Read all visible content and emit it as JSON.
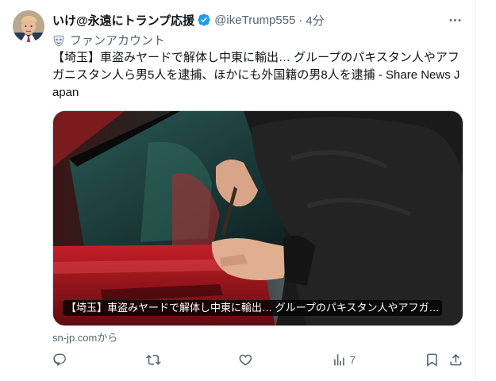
{
  "tweet": {
    "display_name": "いけ@永遠にトランプ応援",
    "handle": "@ikeTrump555",
    "separator": "·",
    "time": "4分",
    "fan_label": "ファンアカウント",
    "text": "【埼玉】車盗みヤードで解体し中東に輸出… グループのパキスタン人やアフガニスタン人ら男5人を逮捕、ほかにも外国籍の男8人を逮捕 - Share News Japan",
    "card_caption": "【埼玉】車盗みヤードで解体し中東に輸出… グループのパキスタン人やアフガ…",
    "source": "sn-jp.comから",
    "views_count": "7"
  },
  "icons": {
    "verified": "verified-badge-icon",
    "more": "more-icon",
    "fan": "fan-mask-icon",
    "reply": "reply-icon",
    "retweet": "retweet-icon",
    "like": "like-icon",
    "views": "views-icon",
    "bookmark": "bookmark-icon",
    "share": "share-icon"
  },
  "colors": {
    "verified_blue": "#1d9bf0",
    "text_primary": "#0f1419",
    "text_secondary": "#536471"
  }
}
